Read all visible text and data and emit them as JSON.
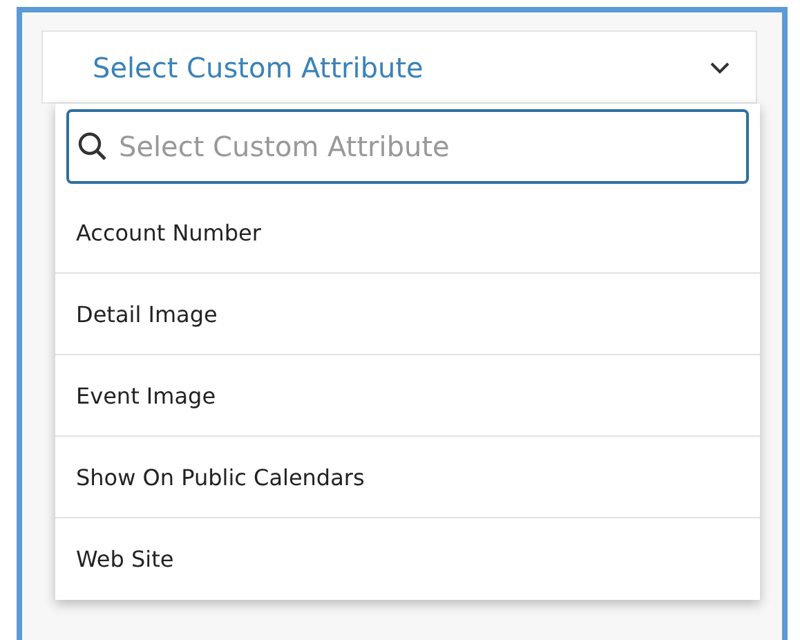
{
  "select": {
    "label": "Select Custom Attribute",
    "expanded": true
  },
  "search": {
    "placeholder": "Select Custom Attribute"
  },
  "options": [
    {
      "label": "Account Number"
    },
    {
      "label": "Detail Image"
    },
    {
      "label": "Event Image"
    },
    {
      "label": "Show On Public Calendars"
    },
    {
      "label": "Web Site"
    }
  ]
}
